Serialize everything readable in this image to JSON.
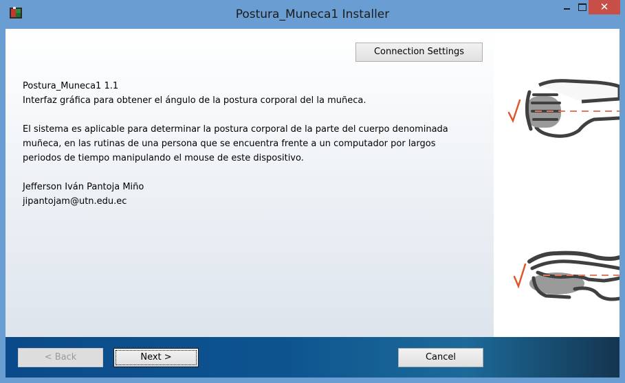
{
  "window": {
    "title": "Postura_Muneca1 Installer",
    "close_glyph": "✕"
  },
  "toolbar": {
    "connection_settings_label": "Connection Settings"
  },
  "info": {
    "product_line": "Postura_Muneca1 1.1",
    "subtitle": "Interfaz gráfica para obtener el ángulo de la postura corporal del la muñeca.",
    "description_lines": [
      "El sistema es aplicable para determinar la postura corporal de la parte del cuerpo denominada",
      "muñeca, en las rutinas de una persona que se encuentra frente a un computador por largos",
      "periodos de tiempo manipulando el mouse de este dispositivo."
    ],
    "author": "Jefferson Iván Pantoja Miño",
    "email": "jipantojam@utn.edu.ec"
  },
  "footer": {
    "back_label": "< Back",
    "next_label": "Next >",
    "cancel_label": "Cancel"
  },
  "icons": {
    "app_icon": "installer-app-icon",
    "illustration_top": "hand-on-mouse-straight-icon",
    "illustration_bottom": "hand-on-mouse-flat-icon"
  },
  "colors": {
    "titlebar": "#6a9ed3",
    "close_button": "#c74f48",
    "footer_bar": "#0d548f",
    "check_mark": "#e0552a",
    "dashed_line": "#e07a5a"
  }
}
